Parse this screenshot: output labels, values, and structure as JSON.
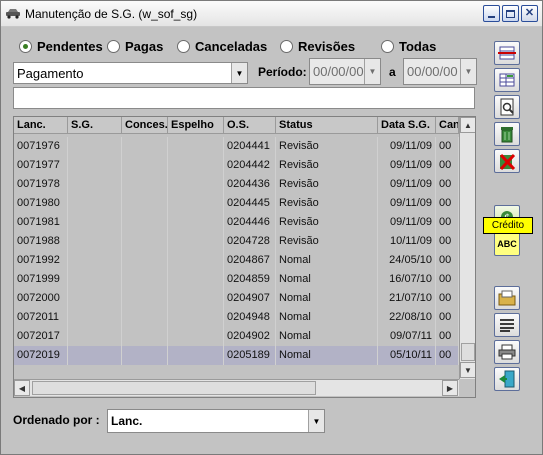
{
  "window": {
    "title": "Manutenção de S.G. (w_sof_sg)"
  },
  "filters": {
    "status_options": [
      {
        "label": "Pendentes",
        "selected": true
      },
      {
        "label": "Pagas",
        "selected": false
      },
      {
        "label": "Canceladas",
        "selected": false
      },
      {
        "label": "Revisões",
        "selected": false
      },
      {
        "label": "Todas",
        "selected": false
      }
    ],
    "type_value": "Pagamento",
    "periodo_label": "Período:",
    "period_from": "00/00/00",
    "a_label": "a",
    "period_to": "00/00/00",
    "text_value": ""
  },
  "grid": {
    "columns": [
      "Lanc.",
      "S.G.",
      "Conces.",
      "Espelho",
      "O.S.",
      "Status",
      "Data S.G.",
      "Can"
    ],
    "rows": [
      [
        "0071976",
        "",
        "",
        "",
        "0204441",
        "Revisão",
        "09/11/09",
        "00"
      ],
      [
        "0071977",
        "",
        "",
        "",
        "0204442",
        "Revisão",
        "09/11/09",
        "00"
      ],
      [
        "0071978",
        "",
        "",
        "",
        "0204436",
        "Revisão",
        "09/11/09",
        "00"
      ],
      [
        "0071980",
        "",
        "",
        "",
        "0204445",
        "Revisão",
        "09/11/09",
        "00"
      ],
      [
        "0071981",
        "",
        "",
        "",
        "0204446",
        "Revisão",
        "09/11/09",
        "00"
      ],
      [
        "0071988",
        "",
        "",
        "",
        "0204728",
        "Revisão",
        "10/11/09",
        "00"
      ],
      [
        "0071992",
        "",
        "",
        "",
        "0204867",
        "Nomal",
        "24/05/10",
        "00"
      ],
      [
        "0071999",
        "",
        "",
        "",
        "0204859",
        "Nomal",
        "16/07/10",
        "00"
      ],
      [
        "0072000",
        "",
        "",
        "",
        "0204907",
        "Nomal",
        "21/07/10",
        "00"
      ],
      [
        "0072011",
        "",
        "",
        "",
        "0204948",
        "Nomal",
        "22/08/10",
        "00"
      ],
      [
        "0072017",
        "",
        "",
        "",
        "0204902",
        "Nomal",
        "09/07/11",
        "00"
      ],
      [
        "0072019",
        "",
        "",
        "",
        "0205189",
        "Nomal",
        "05/10/11",
        "00"
      ]
    ],
    "selected_row": 11
  },
  "toolbar": {
    "icons": [
      "insert-row-icon",
      "edit-grid-icon",
      "preview-icon",
      "trash-icon",
      "cancel-icon",
      "credit-icon",
      "spellcheck-icon",
      "folder-open-icon",
      "text-lines-icon",
      "print-icon",
      "exit-icon"
    ],
    "tooltip": "Crédito",
    "spell_text": "ABC"
  },
  "order": {
    "label": "Ordenado por :",
    "value": "Lanc."
  }
}
